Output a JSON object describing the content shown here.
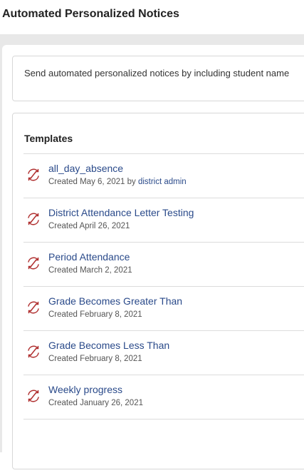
{
  "page": {
    "title": "Automated Personalized Notices"
  },
  "info": {
    "text": "Send automated personalized notices by including student name"
  },
  "templates": {
    "heading": "Templates",
    "icon": "automation-cycle-icon",
    "icon_color": "#b03030",
    "link_color": "#2a4a8a",
    "items": [
      {
        "name": "all_day_absence",
        "created": "Created May 6, 2021",
        "by": " by ",
        "author": "district admin"
      },
      {
        "name": "District Attendance Letter Testing",
        "created": "Created April 26, 2021"
      },
      {
        "name": "Period Attendance",
        "created": "Created March 2, 2021"
      },
      {
        "name": "Grade Becomes Greater Than",
        "created": "Created February 8, 2021"
      },
      {
        "name": "Grade Becomes Less Than",
        "created": "Created February 8, 2021"
      },
      {
        "name": "Weekly progress",
        "created": "Created January 26, 2021"
      }
    ]
  }
}
